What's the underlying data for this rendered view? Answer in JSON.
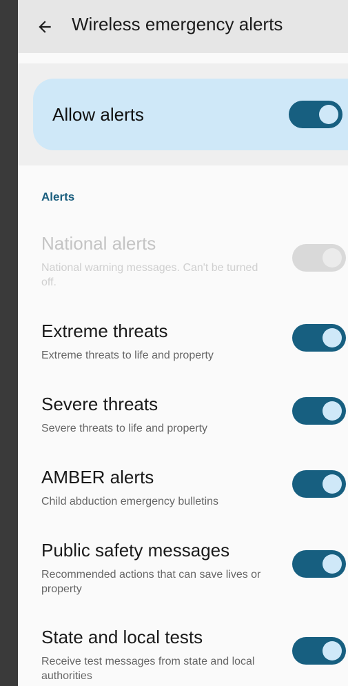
{
  "app_bar": {
    "title": "Wireless emergency alerts",
    "back_icon": "arrow-left-icon"
  },
  "allow_alerts": {
    "label": "Allow alerts",
    "enabled": true
  },
  "section": {
    "header": "Alerts"
  },
  "rows": [
    {
      "title": "National alerts",
      "subtitle": "National warning messages. Can't be turned off.",
      "enabled": true,
      "disabled": true
    },
    {
      "title": "Extreme threats",
      "subtitle": "Extreme threats to life and property",
      "enabled": true,
      "disabled": false
    },
    {
      "title": "Severe threats",
      "subtitle": "Severe threats to life and property",
      "enabled": true,
      "disabled": false
    },
    {
      "title": "AMBER alerts",
      "subtitle": "Child abduction emergency bulletins",
      "enabled": true,
      "disabled": false
    },
    {
      "title": "Public safety messages",
      "subtitle": "Recommended actions that can save lives or property",
      "enabled": true,
      "disabled": false
    },
    {
      "title": "State and local tests",
      "subtitle": "Receive test messages from state and local authorities",
      "enabled": true,
      "disabled": false
    }
  ],
  "colors": {
    "accent": "#175f80",
    "card": "#cfe8f8",
    "section_header": "#1a5e7e"
  }
}
